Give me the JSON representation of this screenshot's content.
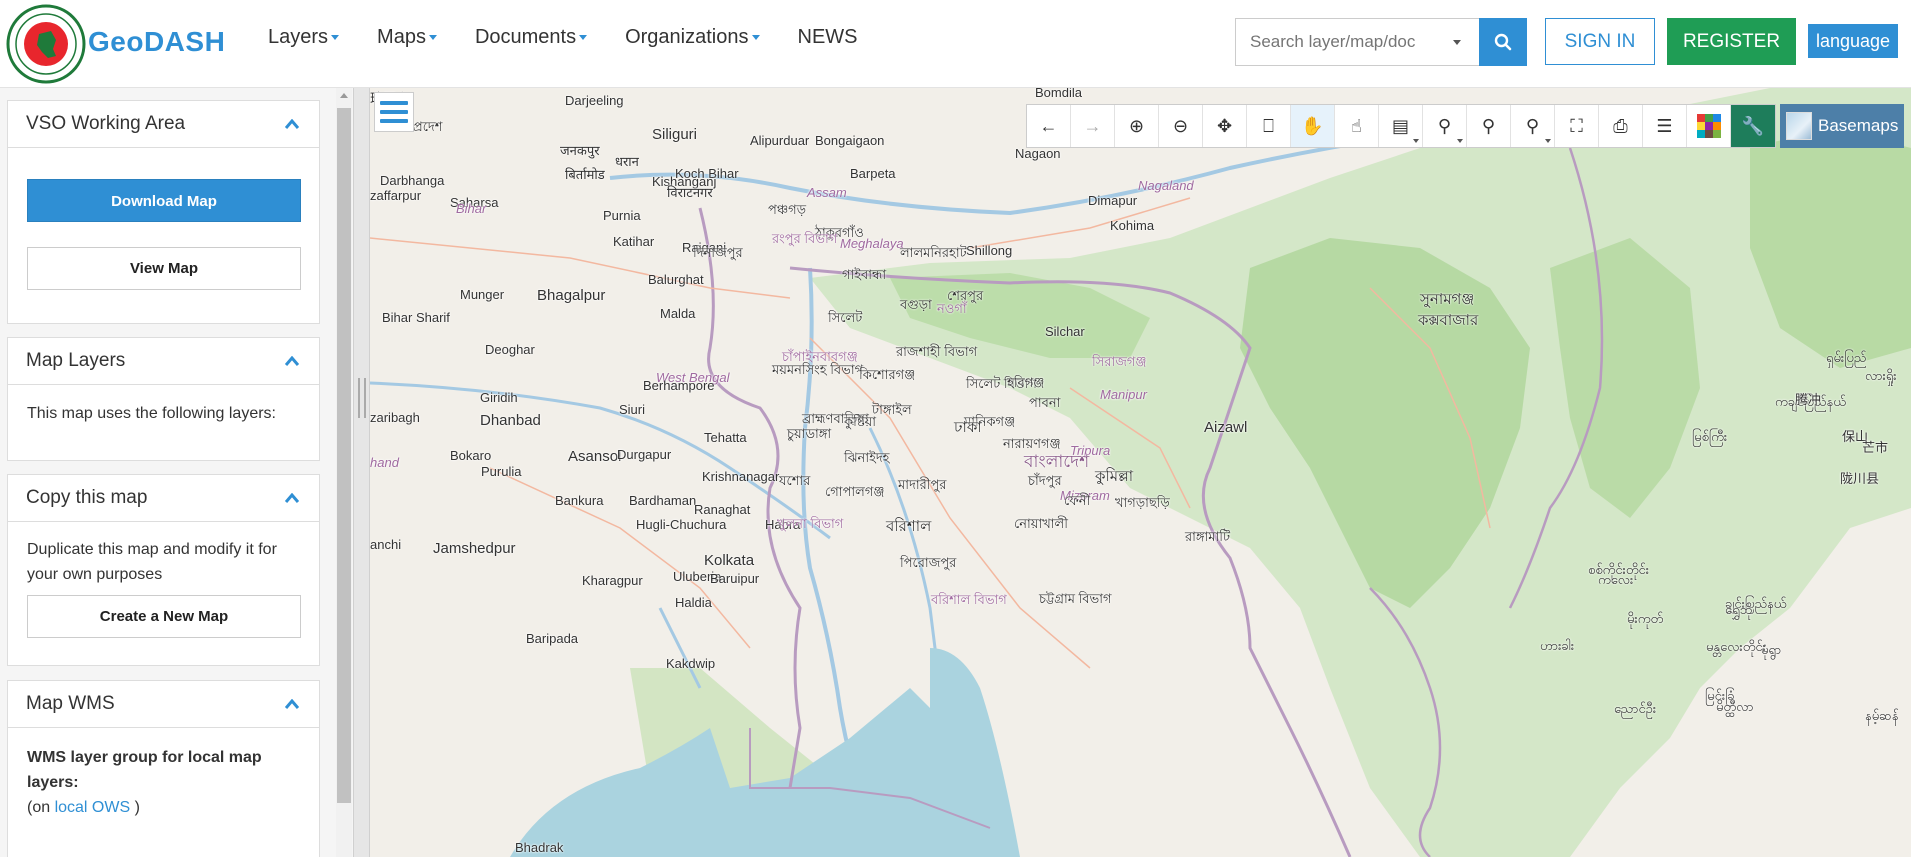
{
  "header": {
    "logo_text": "GeoDASH",
    "nav": [
      {
        "label": "Layers",
        "dropdown": true
      },
      {
        "label": "Maps",
        "dropdown": true
      },
      {
        "label": "Documents",
        "dropdown": true
      },
      {
        "label": "Organizations",
        "dropdown": true
      },
      {
        "label": "NEWS",
        "dropdown": false
      }
    ],
    "search_placeholder": "Search layer/map/doc",
    "sign_in": "SIGN IN",
    "register": "REGISTER",
    "language": "language"
  },
  "sidebar": {
    "working_area": {
      "title": "VSO Working Area",
      "download_button": "Download Map",
      "view_button": "View Map"
    },
    "map_layers": {
      "title": "Map Layers",
      "text": "This map uses the following layers:"
    },
    "copy_map": {
      "title": "Copy this map",
      "text": "Duplicate this map and modify it for your own purposes",
      "button": "Create a New Map"
    },
    "map_wms": {
      "title": "Map WMS",
      "bold_text": "WMS layer group for local map layers:",
      "prefix": "(on",
      "link": "local OWS",
      "suffix": ")"
    }
  },
  "map": {
    "basemaps_label": "Basemaps",
    "toolbar": [
      "back-icon",
      "forward-icon",
      "zoom-in-icon",
      "zoom-out-icon",
      "pan-icon",
      "zoom-box-icon",
      "drag-icon",
      "select-icon",
      "measure-icon",
      "marker-icon",
      "query-icon",
      "query-info-icon",
      "zoom-extent-icon",
      "print-icon",
      "legend-icon",
      "color-grid-icon",
      "wrench-icon"
    ],
    "labels": [
      {
        "t": "Bomdila"
      },
      {
        "t": "Darjeeling"
      },
      {
        "t": "Siliguri"
      },
      {
        "t": "Alipurduar"
      },
      {
        "t": "Bongaigaon"
      },
      {
        "t": "Nagaon"
      },
      {
        "t": "Koch Bihar"
      },
      {
        "t": "Barpeta"
      },
      {
        "t": "Assam"
      },
      {
        "t": "Nagaland"
      },
      {
        "t": "Dimapur"
      },
      {
        "t": "Kohima"
      },
      {
        "t": "Darbhanga"
      },
      {
        "t": "Saharsa"
      },
      {
        "t": "Bihar"
      },
      {
        "t": "Purnia"
      },
      {
        "t": "Kishanganj"
      },
      {
        "t": "Katihar"
      },
      {
        "t": "Raiganj"
      },
      {
        "t": "Meghalaya"
      },
      {
        "t": "Shillong"
      },
      {
        "t": "Munger"
      },
      {
        "t": "Bhagalpur"
      },
      {
        "t": "Balurghat"
      },
      {
        "t": "Bihar Sharif"
      },
      {
        "t": "Malda"
      },
      {
        "t": "Silchar"
      },
      {
        "t": "Manipur"
      },
      {
        "t": "Deoghar"
      },
      {
        "t": "West Bengal"
      },
      {
        "t": "Berhampore"
      },
      {
        "t": "Giridih"
      },
      {
        "t": "Dhanbad"
      },
      {
        "t": "Siuri"
      },
      {
        "t": "Aizawl"
      },
      {
        "t": "Tripura"
      },
      {
        "t": "Bokaro"
      },
      {
        "t": "Asansol"
      },
      {
        "t": "Tehatta"
      },
      {
        "t": "Durgapur"
      },
      {
        "t": "Purulia"
      },
      {
        "t": "Krishnanagar"
      },
      {
        "t": "Bankura"
      },
      {
        "t": "Bardhaman"
      },
      {
        "t": "Ranaghat"
      },
      {
        "t": "Mizoram"
      },
      {
        "t": "Hugli-Chuchura"
      },
      {
        "t": "Habra"
      },
      {
        "t": "Jamshedpur"
      },
      {
        "t": "Kolkata"
      },
      {
        "t": "Kharagpur"
      },
      {
        "t": "Uluberia"
      },
      {
        "t": "Baruipur"
      },
      {
        "t": "Haldia"
      },
      {
        "t": "Baripada"
      },
      {
        "t": "Kakdwip"
      },
      {
        "t": "Bhadrak"
      },
      {
        "t": "zaffarpur"
      },
      {
        "t": "zaribagh"
      },
      {
        "t": "anchi"
      },
      {
        "t": "hand"
      },
      {
        "t": "প্রদেশ"
      },
      {
        "t": "जनकपुर"
      },
      {
        "t": "धरान"
      },
      {
        "t": "बिर्तामोड"
      },
      {
        "t": "विराटनगर"
      },
      {
        "t": "পঞ্চগড়"
      },
      {
        "t": "ঠাকুরগাঁও"
      },
      {
        "t": "লালমনিরহাট"
      },
      {
        "t": "রংপুর বিভাগ"
      },
      {
        "t": "দিনাজপুর"
      },
      {
        "t": "গাইবান্ধা"
      },
      {
        "t": "শেরপুর"
      },
      {
        "t": "সুনামগঞ্জ"
      },
      {
        "t": "সিলেট"
      },
      {
        "t": "বগুড়া"
      },
      {
        "t": "নওগাঁ"
      },
      {
        "t": "ময়মনসিংহ বিভাগ"
      },
      {
        "t": "চাঁপাইনবাবগঞ্জ"
      },
      {
        "t": "রাজশাহী বিভাগ"
      },
      {
        "t": "সিরাজগঞ্জ"
      },
      {
        "t": "সিলেট বিভাগ"
      },
      {
        "t": "হবিগঞ্জ"
      },
      {
        "t": "কিশোরগঞ্জ"
      },
      {
        "t": "টাঙ্গাইল"
      },
      {
        "t": "পাবনা"
      },
      {
        "t": "ব্রাহ্মণবাড়িয়া"
      },
      {
        "t": "কুষ্টিয়া"
      },
      {
        "t": "মানিকগঞ্জ"
      },
      {
        "t": "ঢাকা"
      },
      {
        "t": "চুয়াডাঙ্গা"
      },
      {
        "t": "নারায়ণগঞ্জ"
      },
      {
        "t": "ঝিনাইদহ"
      },
      {
        "t": "বাংলাদেশ"
      },
      {
        "t": "কুমিল্লা"
      },
      {
        "t": "যশোর"
      },
      {
        "t": "মাদারীপুর"
      },
      {
        "t": "চাঁদপুর"
      },
      {
        "t": "গোপালগঞ্জ"
      },
      {
        "t": "ফেনী"
      },
      {
        "t": "খাগড়াছড়ি"
      },
      {
        "t": "খুলনা বিভাগ"
      },
      {
        "t": "বরিশাল"
      },
      {
        "t": "নোয়াখালী"
      },
      {
        "t": "রাঙ্গামাটি"
      },
      {
        "t": "পিরোজপুর"
      },
      {
        "t": "বরিশাল বিভাগ"
      },
      {
        "t": "চট্টগ্রাম বিভাগ"
      },
      {
        "t": "কক্সবাজার"
      },
      {
        "t": "ကချင်ပြည်နယ်"
      },
      {
        "t": "မြစ်ကြီး"
      },
      {
        "t": "စစ်ကိုင်းတိုင်း"
      },
      {
        "t": "ကလေး"
      },
      {
        "t": "ဟားခါး"
      },
      {
        "t": "ချင်းပြည်နယ်"
      },
      {
        "t": "မိုးကုတ်"
      },
      {
        "t": "ရွှေဘို"
      },
      {
        "t": "မုံရွာ"
      },
      {
        "t": "မန္တလေးတိုင်း"
      },
      {
        "t": "မြင်းခြံ"
      },
      {
        "t": "ညောင်ဦး"
      },
      {
        "t": "မိတ္ထီလာ"
      },
      {
        "t": "နမ့်ဆန်"
      },
      {
        "t": "လားရှိုး"
      },
      {
        "t": "ရှမ်းပြည်"
      },
      {
        "t": "腾冲"
      },
      {
        "t": "保山"
      },
      {
        "t": "芒市"
      },
      {
        "t": "陇川县"
      },
      {
        "t": "瑞丽市"
      }
    ]
  }
}
